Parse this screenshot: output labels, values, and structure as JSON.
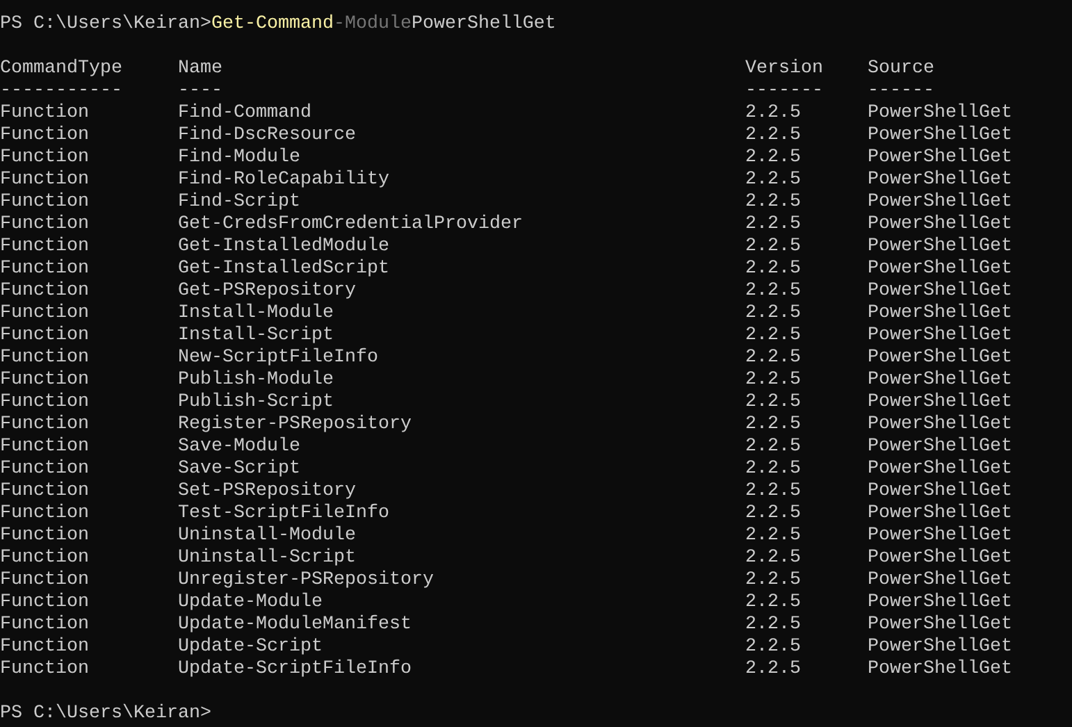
{
  "command_line": {
    "prompt": "PS C:\\Users\\Keiran>",
    "tokens": [
      {
        "kind": "cmdlet",
        "text": "Get-Command"
      },
      {
        "kind": "parameter",
        "text": "-Module"
      },
      {
        "kind": "argument",
        "text": "PowerShellGet"
      }
    ]
  },
  "table": {
    "columns": [
      {
        "header": "CommandType",
        "underline": "-----------"
      },
      {
        "header": "Name",
        "underline": "----"
      },
      {
        "header": "Version",
        "underline": "-------"
      },
      {
        "header": "Source",
        "underline": "------"
      }
    ],
    "rows": [
      [
        "Function",
        "Find-Command",
        "2.2.5",
        "PowerShellGet"
      ],
      [
        "Function",
        "Find-DscResource",
        "2.2.5",
        "PowerShellGet"
      ],
      [
        "Function",
        "Find-Module",
        "2.2.5",
        "PowerShellGet"
      ],
      [
        "Function",
        "Find-RoleCapability",
        "2.2.5",
        "PowerShellGet"
      ],
      [
        "Function",
        "Find-Script",
        "2.2.5",
        "PowerShellGet"
      ],
      [
        "Function",
        "Get-CredsFromCredentialProvider",
        "2.2.5",
        "PowerShellGet"
      ],
      [
        "Function",
        "Get-InstalledModule",
        "2.2.5",
        "PowerShellGet"
      ],
      [
        "Function",
        "Get-InstalledScript",
        "2.2.5",
        "PowerShellGet"
      ],
      [
        "Function",
        "Get-PSRepository",
        "2.2.5",
        "PowerShellGet"
      ],
      [
        "Function",
        "Install-Module",
        "2.2.5",
        "PowerShellGet"
      ],
      [
        "Function",
        "Install-Script",
        "2.2.5",
        "PowerShellGet"
      ],
      [
        "Function",
        "New-ScriptFileInfo",
        "2.2.5",
        "PowerShellGet"
      ],
      [
        "Function",
        "Publish-Module",
        "2.2.5",
        "PowerShellGet"
      ],
      [
        "Function",
        "Publish-Script",
        "2.2.5",
        "PowerShellGet"
      ],
      [
        "Function",
        "Register-PSRepository",
        "2.2.5",
        "PowerShellGet"
      ],
      [
        "Function",
        "Save-Module",
        "2.2.5",
        "PowerShellGet"
      ],
      [
        "Function",
        "Save-Script",
        "2.2.5",
        "PowerShellGet"
      ],
      [
        "Function",
        "Set-PSRepository",
        "2.2.5",
        "PowerShellGet"
      ],
      [
        "Function",
        "Test-ScriptFileInfo",
        "2.2.5",
        "PowerShellGet"
      ],
      [
        "Function",
        "Uninstall-Module",
        "2.2.5",
        "PowerShellGet"
      ],
      [
        "Function",
        "Uninstall-Script",
        "2.2.5",
        "PowerShellGet"
      ],
      [
        "Function",
        "Unregister-PSRepository",
        "2.2.5",
        "PowerShellGet"
      ],
      [
        "Function",
        "Update-Module",
        "2.2.5",
        "PowerShellGet"
      ],
      [
        "Function",
        "Update-ModuleManifest",
        "2.2.5",
        "PowerShellGet"
      ],
      [
        "Function",
        "Update-Script",
        "2.2.5",
        "PowerShellGet"
      ],
      [
        "Function",
        "Update-ScriptFileInfo",
        "2.2.5",
        "PowerShellGet"
      ]
    ]
  },
  "final_prompt": "PS C:\\Users\\Keiran>"
}
